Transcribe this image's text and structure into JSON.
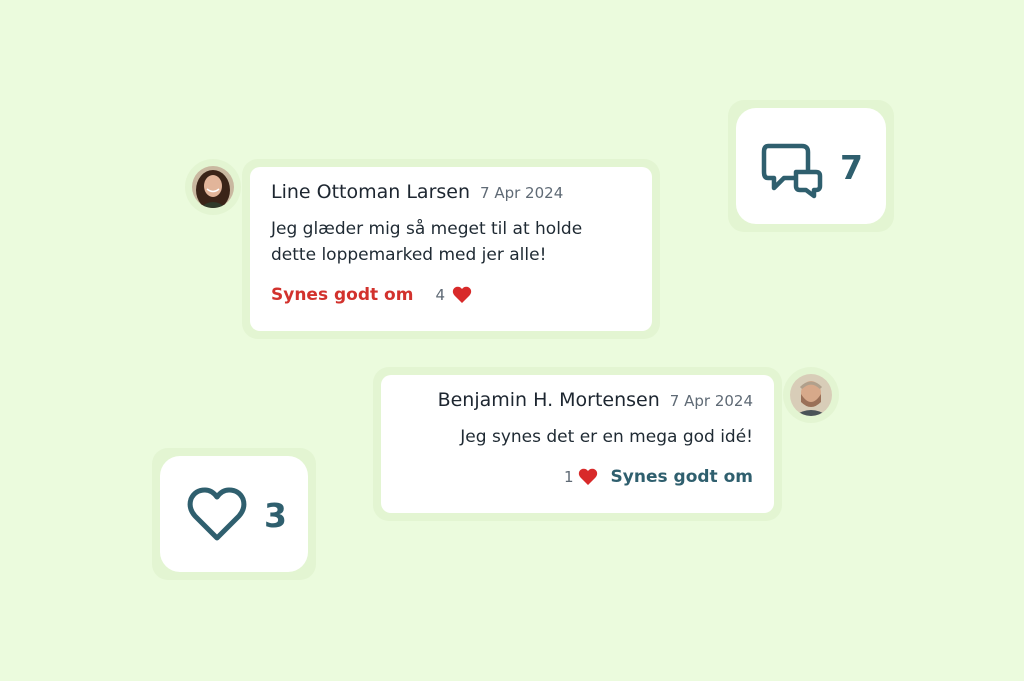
{
  "stats": {
    "comments": {
      "icon": "comments-icon",
      "value": "7"
    },
    "likes": {
      "icon": "heart-outline-icon",
      "value": "3"
    }
  },
  "comments": [
    {
      "author": "Line Ottoman Larsen",
      "date": "7 Apr 2024",
      "text_line1": "Jeg glæder mig så meget til at holde",
      "text_line2": "dette loppemarked med jer alle!",
      "like_label": "Synes godt om",
      "like_count": "4",
      "like_label_color": "#d2322d"
    },
    {
      "author": "Benjamin H. Mortensen",
      "date": "7 Apr 2024",
      "text": "Jeg synes det er en mega god idé!",
      "like_label": "Synes godt om",
      "like_count": "1",
      "like_label_color": "#2f5f6e"
    }
  ],
  "colors": {
    "background": "#ebfbdd",
    "icon": "#2f5f6e",
    "heart": "#d82a2a"
  }
}
